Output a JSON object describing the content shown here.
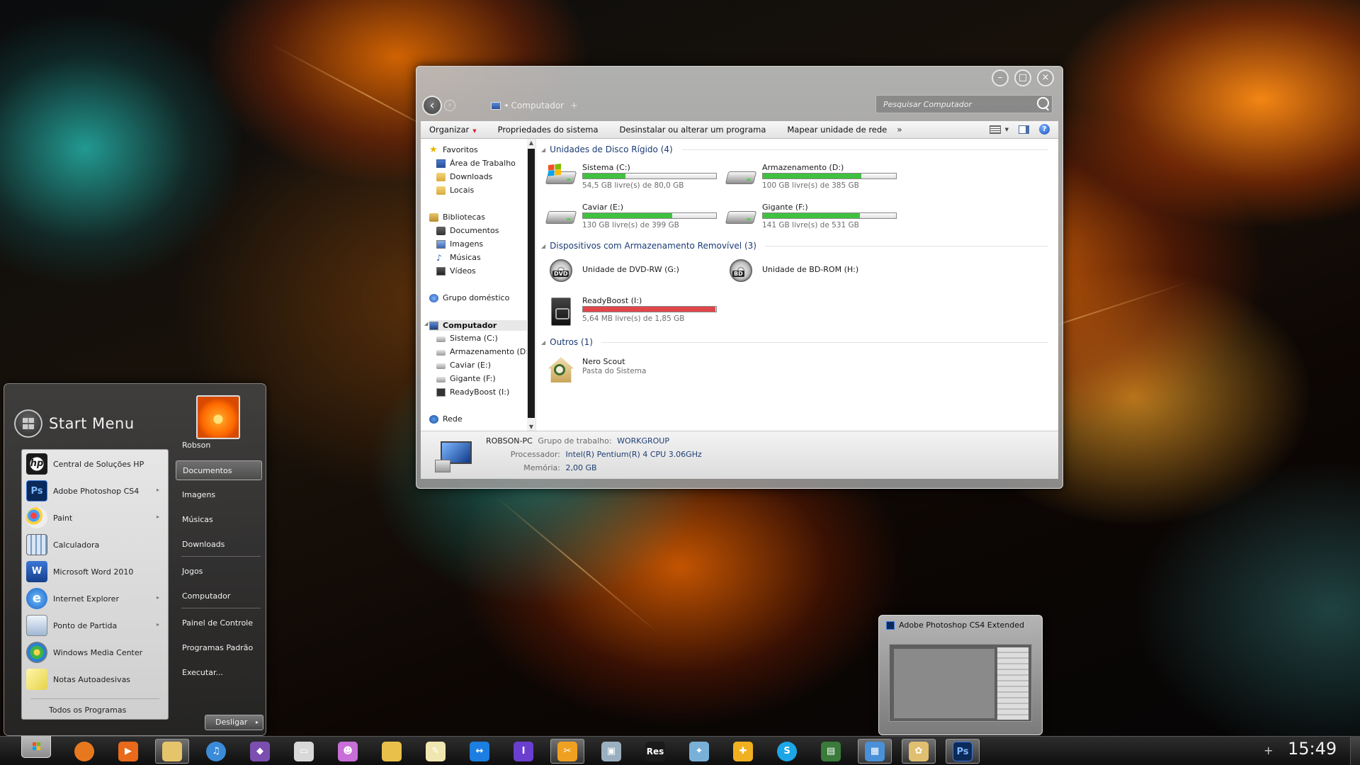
{
  "explorer": {
    "title_controls": {
      "minimize": "–",
      "maximize": "□",
      "close": "×"
    },
    "breadcrumb": {
      "arrow": "◂",
      "location": "Computador",
      "plus": "+"
    },
    "search_placeholder": "Pesquisar Computador",
    "toolbar": {
      "organize": "Organizar",
      "system_properties": "Propriedades do sistema",
      "uninstall": "Desinstalar ou alterar um programa",
      "map_drive": "Mapear unidade de rede",
      "more": "»",
      "help": "?"
    },
    "nav": {
      "favorites": "Favoritos",
      "desktop": "Área de Trabalho",
      "downloads": "Downloads",
      "places": "Locais",
      "libraries": "Bibliotecas",
      "documents": "Documentos",
      "pictures": "Imagens",
      "music": "Músicas",
      "videos": "Vídeos",
      "homegroup": "Grupo doméstico",
      "computer": "Computador",
      "drive_c": "Sistema (C:)",
      "drive_d": "Armazenamento (D:)",
      "drive_e": "Caviar (E:)",
      "drive_f": "Gigante (F:)",
      "drive_i": "ReadyBoost (I:)",
      "network": "Rede"
    },
    "groups": {
      "hdd": "Unidades de Disco Rígido (4)",
      "removable": "Dispositivos com Armazenamento Removível (3)",
      "others": "Outros (1)"
    },
    "drives": [
      {
        "name": "Sistema (C:)",
        "free": "54,5 GB livre(s) de 80,0 GB",
        "used_fraction": 0.32
      },
      {
        "name": "Armazenamento (D:)",
        "free": "100 GB livre(s) de 385 GB",
        "used_fraction": 0.74
      },
      {
        "name": "Caviar (E:)",
        "free": "130 GB livre(s) de 399 GB",
        "used_fraction": 0.67
      },
      {
        "name": "Gigante (F:)",
        "free": "141 GB livre(s) de 531 GB",
        "used_fraction": 0.73
      }
    ],
    "removable": {
      "dvd": "Unidade de DVD-RW (G:)",
      "dvd_badge": "DVD",
      "bd": "Unidade de BD-ROM (H:)",
      "bd_badge": "BD",
      "readyboost": {
        "name": "ReadyBoost (I:)",
        "free": "5,64 MB livre(s) de 1,85 GB",
        "used_fraction": 0.997
      }
    },
    "others": {
      "name": "Nero Scout",
      "sub": "Pasta do Sistema"
    },
    "details": {
      "pc_name": "ROBSON-PC",
      "workgroup_label": "Grupo de trabalho:",
      "workgroup": "WORKGROUP",
      "processor_label": "Processador:",
      "processor": "Intel(R) Pentium(R) 4 CPU 3.06GHz",
      "memory_label": "Memória:",
      "memory": "2,00 GB"
    },
    "colors": {
      "bar_ok": "#3fc13f",
      "bar_full": "#e0474b"
    }
  },
  "startmenu": {
    "title": "Start Menu",
    "programs": [
      {
        "label": "Central de Soluções HP",
        "icon": "hp-icon",
        "glyph": "hp"
      },
      {
        "label": "Adobe Photoshop CS4",
        "icon": "photoshop-icon",
        "glyph": "Ps"
      },
      {
        "label": "Paint",
        "icon": "paint-icon",
        "glyph": ""
      },
      {
        "label": "Calculadora",
        "icon": "calculator-icon",
        "glyph": ""
      },
      {
        "label": "Microsoft Word 2010",
        "icon": "word-icon",
        "glyph": "W"
      },
      {
        "label": "Internet Explorer",
        "icon": "internet-explorer-icon",
        "glyph": "e"
      },
      {
        "label": "Ponto de Partida",
        "icon": "getting-started-icon",
        "glyph": ""
      },
      {
        "label": "Windows Media Center",
        "icon": "media-center-icon",
        "glyph": ""
      },
      {
        "label": "Notas Autoadesivas",
        "icon": "sticky-notes-icon",
        "glyph": ""
      }
    ],
    "all_programs": "Todos os Programas",
    "right": {
      "user": "Robson",
      "documents": "Documentos",
      "pictures": "Imagens",
      "music": "Músicas",
      "downloads": "Downloads",
      "games": "Jogos",
      "computer": "Computador",
      "control_panel": "Painel de Controle",
      "default_programs": "Programas Padrão",
      "run": "Executar..."
    },
    "shutdown": "Desligar",
    "shutdown_arrow": "▸"
  },
  "taskbar": {
    "clock": "15:49",
    "tray_plus": "+",
    "icons": [
      {
        "name": "firefox-icon",
        "glyph": "",
        "color": "#e8781e"
      },
      {
        "name": "media-player-icon",
        "glyph": "▶",
        "color": "#e86a1a"
      },
      {
        "name": "explorer-icon",
        "glyph": "",
        "color": "#e6c56a"
      },
      {
        "name": "itunes-icon",
        "glyph": "♫",
        "color": "#3a8bd8"
      },
      {
        "name": "visual-studio-icon",
        "glyph": "◆",
        "color": "#7b4fb0"
      },
      {
        "name": "remote-desktop-icon",
        "glyph": "▭",
        "color": "#d8d8d8"
      },
      {
        "name": "messenger-icon",
        "glyph": "☻",
        "color": "#c86ed8"
      },
      {
        "name": "folder-icon",
        "glyph": "",
        "color": "#e8c04a"
      },
      {
        "name": "notepad-icon",
        "glyph": "✎",
        "color": "#f0e6b0"
      },
      {
        "name": "teamviewer-icon",
        "glyph": "↔",
        "color": "#1b7ee0"
      },
      {
        "name": "ibooks-icon",
        "glyph": "I",
        "color": "#6a3fd0"
      },
      {
        "name": "clapper-icon",
        "glyph": "✂",
        "color": "#f0a020"
      },
      {
        "name": "window-icon",
        "glyph": "▣",
        "color": "#9ab0c0"
      },
      {
        "name": "res-icon",
        "glyph": "Res",
        "color": "#1a1a1a"
      },
      {
        "name": "network-users-icon",
        "glyph": "✦",
        "color": "#78b0d8"
      },
      {
        "name": "puzzle-icon",
        "glyph": "✚",
        "color": "#f0b020"
      },
      {
        "name": "skype-icon",
        "glyph": "S",
        "color": "#1ca6e8"
      },
      {
        "name": "task-manager-icon",
        "glyph": "▤",
        "color": "#3a7a3a"
      },
      {
        "name": "control-panel-icon",
        "glyph": "▦",
        "color": "#4a90d8"
      },
      {
        "name": "paint-task-icon",
        "glyph": "✿",
        "color": "#e0c070"
      },
      {
        "name": "photoshop-task-icon",
        "glyph": "Ps",
        "color": "#0b2a5a"
      }
    ]
  },
  "thumbnail": {
    "title": "Adobe Photoshop CS4 Extended"
  }
}
